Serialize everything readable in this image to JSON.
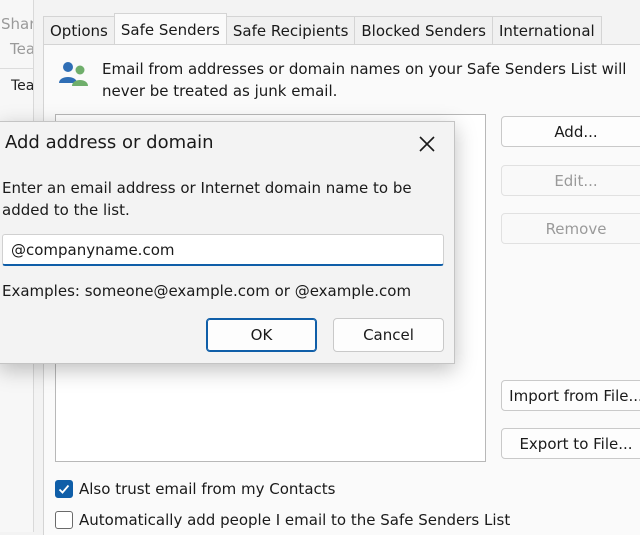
{
  "background_window": {
    "texts": [
      "Shar",
      "Tea",
      "Tea"
    ]
  },
  "tabs": [
    {
      "label": "Options",
      "active": false
    },
    {
      "label": "Safe Senders",
      "active": true
    },
    {
      "label": "Safe Recipients",
      "active": false
    },
    {
      "label": "Blocked Senders",
      "active": false
    },
    {
      "label": "International",
      "active": false
    }
  ],
  "info": {
    "icon": "people-icon",
    "text": "Email from addresses or domain names on your Safe Senders List will never be treated as junk email."
  },
  "buttons": {
    "add": "Add...",
    "edit": "Edit...",
    "remove": "Remove",
    "import": "Import from File...",
    "export": "Export to File..."
  },
  "checkboxes": {
    "trust_contacts": {
      "label": "Also trust email from my Contacts",
      "checked": true
    },
    "auto_add": {
      "label": "Automatically add people I email to the Safe Senders List",
      "checked": false
    }
  },
  "modal": {
    "title": "Add address or domain",
    "prompt": "Enter an email address or Internet domain name to be added to the list.",
    "input_value": "@companyname.com",
    "examples": "Examples: someone@example.com or @example.com",
    "ok_label": "OK",
    "cancel_label": "Cancel"
  },
  "colors": {
    "accent": "#0f5ea8"
  }
}
